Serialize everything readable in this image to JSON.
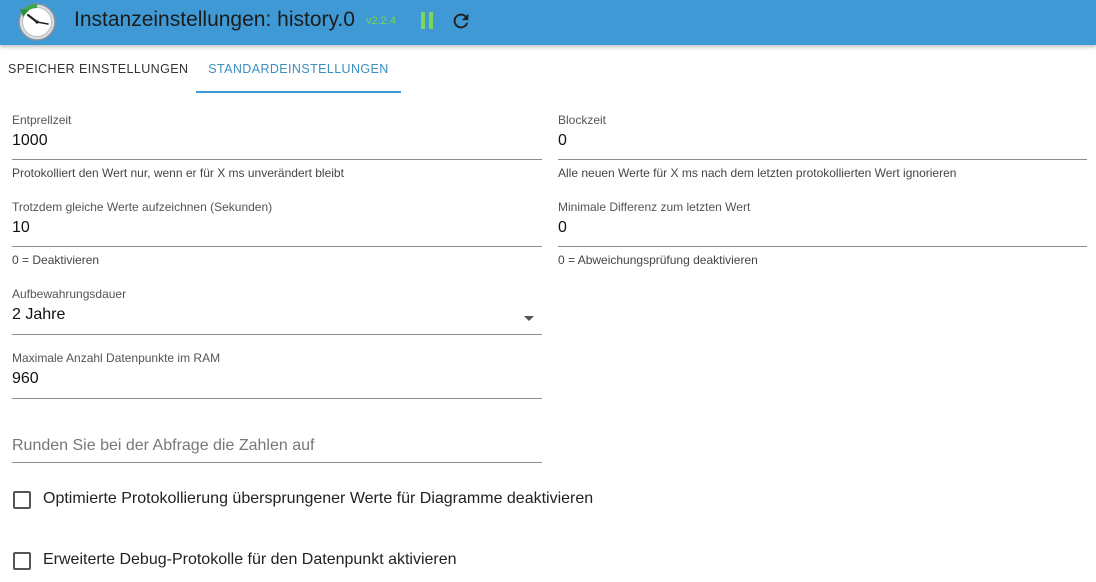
{
  "header": {
    "title": "Instanzeinstellungen: history.0",
    "version": "v2.2.4",
    "colors": {
      "bar": "#3f99d4",
      "version": "#79d64f",
      "pause": "#7fd45a"
    }
  },
  "tabs": [
    {
      "label": "SPEICHER EINSTELLUNGEN",
      "active": false
    },
    {
      "label": "STANDARDEINSTELLUNGEN",
      "active": true
    }
  ],
  "fields": {
    "entprellzeit": {
      "label": "Entprellzeit",
      "value": "1000",
      "helper": "Protokolliert den Wert nur, wenn er für X ms unverändert bleibt"
    },
    "blockzeit": {
      "label": "Blockzeit",
      "value": "0",
      "helper": "Alle neuen Werte für X ms nach dem letzten protokollierten Wert ignorieren"
    },
    "trotzdem": {
      "label": "Trotzdem gleiche Werte aufzeichnen (Sekunden)",
      "value": "10",
      "helper": "0 = Deaktivieren"
    },
    "mindiff": {
      "label": "Minimale Differenz zum letzten Wert",
      "value": "0",
      "helper": "0 = Abweichungsprüfung deaktivieren"
    },
    "aufbewahrung": {
      "label": "Aufbewahrungsdauer",
      "value": "2 Jahre"
    },
    "maxram": {
      "label": "Maximale Anzahl Datenpunkte im RAM",
      "value": "960"
    },
    "runden": {
      "placeholder": "Runden Sie bei der Abfrage die Zahlen auf"
    }
  },
  "checkboxes": [
    {
      "label": "Optimierte Protokollierung übersprungener Werte für Diagramme deaktivieren",
      "checked": false
    },
    {
      "label": "Erweiterte Debug-Protokolle für den Datenpunkt aktivieren",
      "checked": false
    }
  ]
}
